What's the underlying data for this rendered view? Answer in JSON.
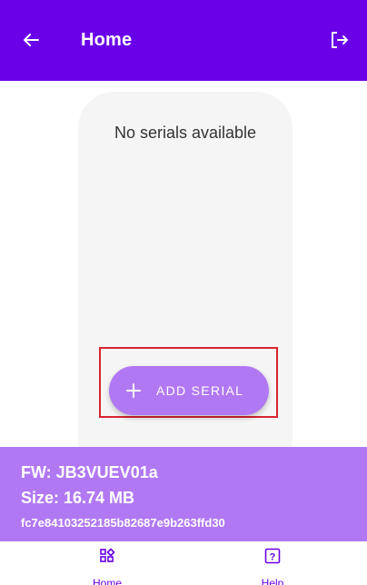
{
  "appbar": {
    "title": "Home",
    "back_icon": "arrow-back-icon",
    "logout_icon": "logout-icon",
    "background": "#6a00e8"
  },
  "main": {
    "empty_message": "No serials available",
    "add_button_label": "ADD SERIAL",
    "add_button_icon": "plus-icon",
    "accent": "#b178f3",
    "highlight_color": "#d9242c"
  },
  "firmware": {
    "fw_label": "FW: JB3VUEV01a",
    "size_label": "Size: 16.74 MB",
    "hash": "fc7e84103252185b82687e9b263ffd30"
  },
  "bottom_nav": {
    "items": [
      {
        "label": "Home",
        "icon": "dashboard-icon"
      },
      {
        "label": "Help",
        "icon": "help-icon"
      }
    ]
  }
}
